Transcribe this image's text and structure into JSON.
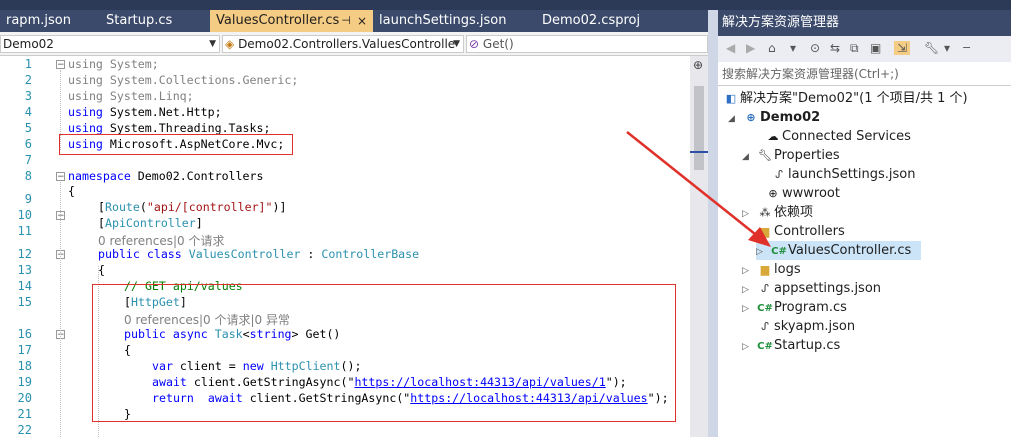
{
  "editor": {
    "tabs": [
      {
        "label": "rapm.json"
      },
      {
        "label": "Startup.cs"
      },
      {
        "label": "ValuesController.cs",
        "pin": "⊣",
        "close": "×"
      },
      {
        "label": "launchSettings.json"
      },
      {
        "label": "Demo02.csproj"
      }
    ],
    "nav": {
      "project": "Demo02",
      "class": "Demo02.Controllers.ValuesControlle",
      "member": "Get()"
    },
    "lines": [
      {
        "n": "1"
      },
      {
        "n": "2"
      },
      {
        "n": "3"
      },
      {
        "n": "4"
      },
      {
        "n": "5"
      },
      {
        "n": "6"
      },
      {
        "n": "7"
      },
      {
        "n": "8"
      },
      {
        "n": "9"
      },
      {
        "n": "10"
      },
      {
        "n": "11"
      },
      {
        "n": "12"
      },
      {
        "n": "13"
      },
      {
        "n": "14"
      },
      {
        "n": "15"
      },
      {
        "n": "16"
      },
      {
        "n": "17"
      },
      {
        "n": "18"
      },
      {
        "n": "19"
      },
      {
        "n": "20"
      },
      {
        "n": "21"
      },
      {
        "n": "22"
      }
    ],
    "code": {
      "using1_kw": "using",
      "using1": " System;",
      "using2_kw": "using",
      "using2": " System.Collections.Generic;",
      "using3_kw": "using",
      "using3": " System.Linq;",
      "using4_kw": "using",
      "using4": " System.Net.Http;",
      "using5_kw": "using",
      "using5": " System.Threading.Tasks;",
      "using6_kw": "using",
      "using6": " Microsoft.AspNetCore.Mvc;",
      "ns_kw": "namespace",
      "ns": " Demo02.Controllers",
      "brace_open": "{",
      "route_open": "[",
      "route_ty": "Route",
      "route_p1": "(",
      "route_str": "\"api/[controller]\"",
      "route_p2": ")]",
      "apictl_open": "[",
      "apictl_ty": "ApiController",
      "apictl_close": "]",
      "refs1": "0 references|0 个请求",
      "cls_kw": "public class",
      "cls_name": " ValuesController",
      "cls_colon": " : ",
      "cls_base": "ControllerBase",
      "brace2": "{",
      "comment": "// GET api/values",
      "httpget_open": "[",
      "httpget_ty": "HttpGet",
      "httpget_close": "]",
      "refs2": "0 references|0 个请求|0 异常",
      "m_kw": "public async",
      "m_task": " Task",
      "m_lt": "<",
      "m_string": "string",
      "m_rest": "> Get()",
      "brace3": "{",
      "l18_kw": "var",
      "l18_a": " client = ",
      "l18_new": "new",
      "l18_ty": " HttpClient",
      "l18_b": "();",
      "l19_kw": "await",
      "l19_a": " client.GetStringAsync(\"",
      "l19_url": "https://localhost:44313/api/values/1",
      "l19_b": "\");",
      "l20_kw": "return",
      "l20_sp": "  ",
      "l20_kw2": "await",
      "l20_a": " client.GetStringAsync(\"",
      "l20_url": "https://localhost:44313/api/values",
      "l20_b": "\");",
      "brace4": "}"
    }
  },
  "solution_explorer": {
    "title": "解决方案资源管理器",
    "search_placeholder": "搜索解决方案资源管理器(Ctrl+;)",
    "nodes": [
      {
        "label": "解决方案\"Demo02\"(1 个项目/共 1 个)",
        "icon": "solution-icon"
      },
      {
        "label": "Demo02",
        "icon": "project-icon"
      },
      {
        "label": "Connected Services",
        "icon": "connected-services-icon"
      },
      {
        "label": "Properties",
        "icon": "wrench-icon"
      },
      {
        "label": "launchSettings.json",
        "icon": "json-file-icon"
      },
      {
        "label": "wwwroot",
        "icon": "globe-icon"
      },
      {
        "label": "依赖项",
        "icon": "dependencies-icon"
      },
      {
        "label": "Controllers",
        "icon": "folder-icon"
      },
      {
        "label": "ValuesController.cs",
        "icon": "csharp-file-icon"
      },
      {
        "label": "logs",
        "icon": "folder-icon"
      },
      {
        "label": "appsettings.json",
        "icon": "json-file-icon"
      },
      {
        "label": "Program.cs",
        "icon": "csharp-file-icon"
      },
      {
        "label": "skyapm.json",
        "icon": "json-file-icon"
      },
      {
        "label": "Startup.cs",
        "icon": "csharp-file-icon"
      }
    ]
  },
  "colors": {
    "annotation": "#e0302a",
    "tab_active": "#f5cc84",
    "title_bar": "#3b4a6b"
  }
}
